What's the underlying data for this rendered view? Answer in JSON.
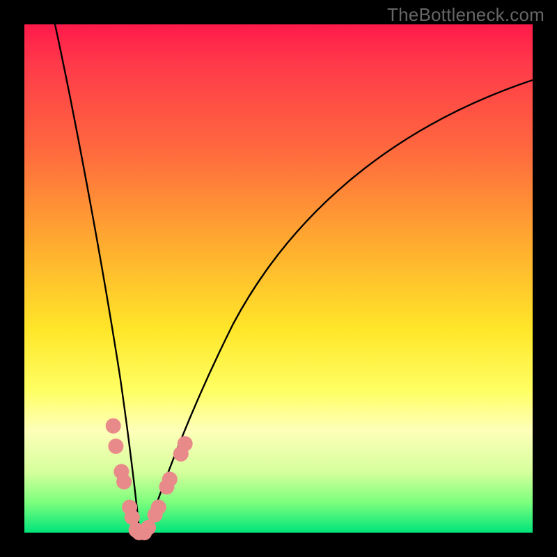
{
  "watermark": "TheBottleneck.com",
  "chart_data": {
    "type": "line",
    "title": "",
    "xlabel": "",
    "ylabel": "",
    "xlim": [
      0,
      100
    ],
    "ylim": [
      0,
      100
    ],
    "legend": false,
    "grid": false,
    "background_gradient": {
      "direction": "vertical",
      "stops": [
        {
          "pos": 0,
          "color": "#ff1a4a"
        },
        {
          "pos": 25,
          "color": "#ff6a3e"
        },
        {
          "pos": 50,
          "color": "#ffd029"
        },
        {
          "pos": 72,
          "color": "#ffff63"
        },
        {
          "pos": 88,
          "color": "#d6ff9c"
        },
        {
          "pos": 100,
          "color": "#00e47a"
        }
      ]
    },
    "series": [
      {
        "name": "left-branch",
        "color": "#000000",
        "x": [
          6,
          8,
          10,
          12,
          14,
          16,
          18,
          19,
          20,
          21,
          22
        ],
        "y": [
          100,
          82,
          66,
          52,
          39,
          27,
          16,
          11,
          7,
          3,
          0
        ]
      },
      {
        "name": "right-branch",
        "color": "#000000",
        "x": [
          24,
          26,
          28,
          31,
          35,
          40,
          46,
          54,
          64,
          76,
          90,
          100
        ],
        "y": [
          0,
          4,
          9,
          16,
          25,
          36,
          47,
          58,
          69,
          78,
          85,
          89
        ]
      }
    ],
    "markers": {
      "color": "#e98a8a",
      "radius_px": 11,
      "points": [
        {
          "x": 17.5,
          "y": 21
        },
        {
          "x": 18.0,
          "y": 17
        },
        {
          "x": 19.1,
          "y": 12
        },
        {
          "x": 19.6,
          "y": 10
        },
        {
          "x": 20.7,
          "y": 5
        },
        {
          "x": 21.2,
          "y": 3
        },
        {
          "x": 22.0,
          "y": 0.5
        },
        {
          "x": 22.6,
          "y": 0
        },
        {
          "x": 23.6,
          "y": 0
        },
        {
          "x": 24.4,
          "y": 1
        },
        {
          "x": 25.7,
          "y": 3.5
        },
        {
          "x": 26.4,
          "y": 5
        },
        {
          "x": 28.0,
          "y": 9
        },
        {
          "x": 28.6,
          "y": 10.5
        },
        {
          "x": 30.8,
          "y": 15.5
        },
        {
          "x": 31.6,
          "y": 17.5
        }
      ]
    }
  }
}
